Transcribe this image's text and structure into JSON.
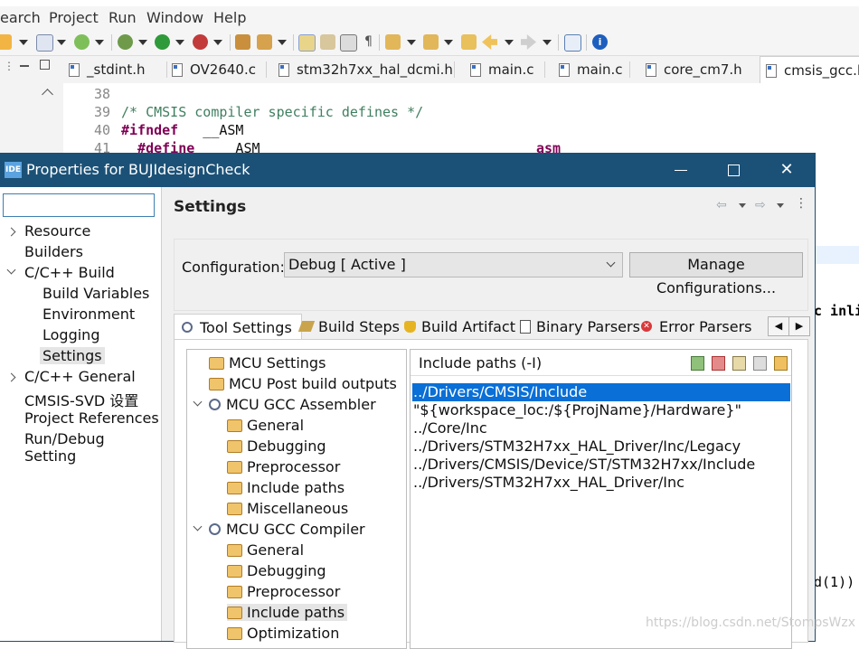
{
  "menubar": [
    "earch",
    "Project",
    "Run",
    "Window",
    "Help"
  ],
  "editor": {
    "tabs": [
      "_stdint.h",
      "OV2640.c",
      "stm32h7xx_hal_dcmi.h",
      "main.c",
      "main.c",
      "core_cm7.h",
      "cmsis_gcc.h"
    ],
    "lines": [
      {
        "num": "38",
        "text": ""
      },
      {
        "num": "39",
        "text": "/* CMSIS compiler specific defines */"
      },
      {
        "num": "40",
        "kw": "#ifndef",
        "rest": "   __ASM"
      },
      {
        "num": "41",
        "kw": "  #define",
        "rest": "   __ASM",
        "tail": "asm"
      }
    ],
    "right_fragments": [
      "c inli",
      "d(1))"
    ]
  },
  "dialog": {
    "title": "Properties for BUJIdesignCheck",
    "icon_text": "IDE",
    "filter_value": "",
    "nav": [
      {
        "label": "Resource",
        "expander": "right"
      },
      {
        "label": "Builders"
      },
      {
        "label": "C/C++ Build",
        "expander": "down"
      },
      {
        "label": "Build Variables",
        "child": true
      },
      {
        "label": "Environment",
        "child": true
      },
      {
        "label": "Logging",
        "child": true
      },
      {
        "label": "Settings",
        "child": true,
        "selected": true
      },
      {
        "label": "C/C++ General",
        "expander": "right"
      },
      {
        "label": "CMSIS-SVD 设置"
      },
      {
        "label": "Project References"
      },
      {
        "label": "Run/Debug Setting"
      }
    ],
    "settings_title": "Settings",
    "configuration_label": "Configuration:",
    "configuration_value": "Debug  [ Active ]",
    "manage_button": "Manage Configurations...",
    "tabs": [
      "Tool Settings",
      "Build Steps",
      "Build Artifact",
      "Binary Parsers",
      "Error Parsers"
    ],
    "tool_tree": [
      {
        "label": "MCU Settings",
        "icon": "folder"
      },
      {
        "label": "MCU Post build outputs",
        "icon": "folder"
      },
      {
        "label": "MCU GCC Assembler",
        "icon": "gear",
        "expanded": true
      },
      {
        "label": "General",
        "icon": "folder",
        "child": true
      },
      {
        "label": "Debugging",
        "icon": "folder",
        "child": true
      },
      {
        "label": "Preprocessor",
        "icon": "folder",
        "child": true
      },
      {
        "label": "Include paths",
        "icon": "folder",
        "child": true
      },
      {
        "label": "Miscellaneous",
        "icon": "folder",
        "child": true
      },
      {
        "label": "MCU GCC Compiler",
        "icon": "gear",
        "expanded": true
      },
      {
        "label": "General",
        "icon": "folder",
        "child": true
      },
      {
        "label": "Debugging",
        "icon": "folder",
        "child": true
      },
      {
        "label": "Preprocessor",
        "icon": "folder",
        "child": true
      },
      {
        "label": "Include paths",
        "icon": "folder",
        "child": true,
        "selected": true
      },
      {
        "label": "Optimization",
        "icon": "folder",
        "child": true
      }
    ],
    "include_label": "Include paths (-I)",
    "include_paths": [
      "../Drivers/CMSIS/Include",
      "\"${workspace_loc:/${ProjName}/Hardware}\"",
      "../Core/Inc",
      "../Drivers/STM32H7xx_HAL_Driver/Inc/Legacy",
      "../Drivers/CMSIS/Device/ST/STM32H7xx/Include",
      "../Drivers/STM32H7xx_HAL_Driver/Inc"
    ],
    "selected_include_index": 0
  },
  "watermark": "https://blog.csdn.net/StompsWzx",
  "colors": {
    "titlebar": "#1b5177",
    "selection": "#0a6fd6",
    "comment": "#3f7f5f",
    "keyword": "#7f0055"
  }
}
